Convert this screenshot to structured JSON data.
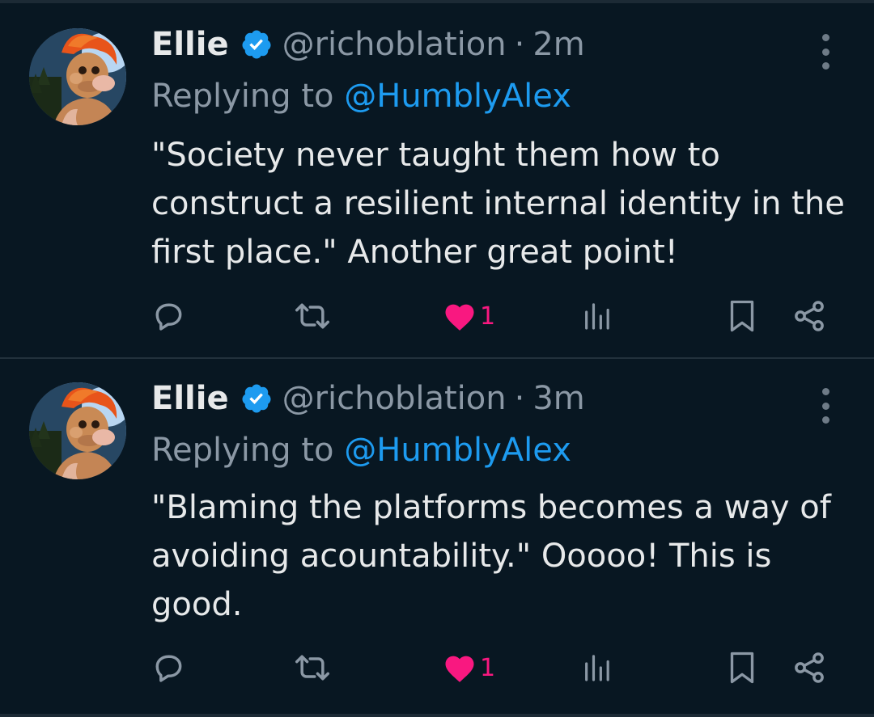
{
  "colors": {
    "background": "#081722",
    "text": "#e7e9ea",
    "muted": "#8b98a5",
    "link": "#1d9bf0",
    "like": "#f91880",
    "verified": "#1d9bf0"
  },
  "tweets": [
    {
      "author_name": "Ellie",
      "verified": true,
      "handle": "@richoblation",
      "separator": "·",
      "time": "2m",
      "reply_prefix": "Replying to",
      "reply_handle": "@HumblyAlex",
      "text": "\"Society never taught them how to construct a resilient internal identity in the first place.\" Another great point!",
      "likes": "1",
      "liked": true,
      "icons": [
        "reply-icon",
        "retweet-icon",
        "heart-icon",
        "views-icon",
        "bookmark-icon",
        "share-icon"
      ]
    },
    {
      "author_name": "Ellie",
      "verified": true,
      "handle": "@richoblation",
      "separator": "·",
      "time": "3m",
      "reply_prefix": "Replying to",
      "reply_handle": "@HumblyAlex",
      "text": "\"Blaming the platforms becomes a way of avoiding acountability.\" Ooooo! This is good.",
      "likes": "1",
      "liked": true,
      "icons": [
        "reply-icon",
        "retweet-icon",
        "heart-icon",
        "views-icon",
        "bookmark-icon",
        "share-icon"
      ]
    }
  ]
}
